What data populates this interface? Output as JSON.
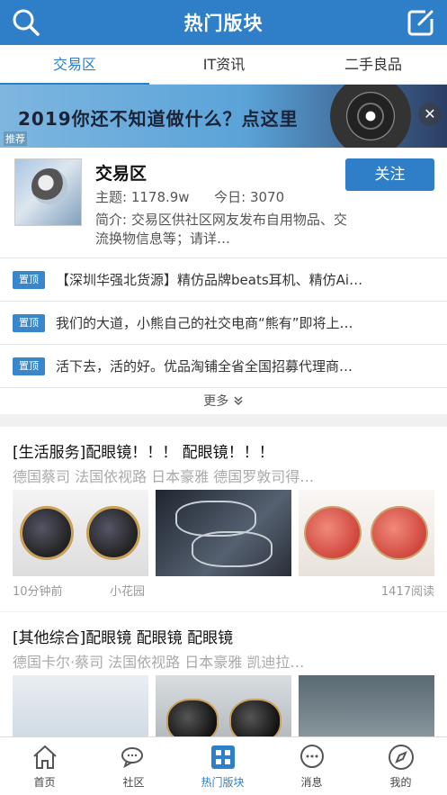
{
  "header": {
    "title": "热门版块",
    "left_icon": "search-icon",
    "right_icon": "edit-icon"
  },
  "tabs": [
    {
      "label": "交易区",
      "active": true
    },
    {
      "label": "IT资讯",
      "active": false
    },
    {
      "label": "二手良品",
      "active": false
    }
  ],
  "banner": {
    "text": "2019你还不知道做什么？点这里",
    "tag": "推荐",
    "close_label": "✕"
  },
  "forum": {
    "name": "交易区",
    "topics_label": "主题: 1178.9w",
    "today_label": "今日: 3070",
    "description": "简介: 交易区供社区网友发布自用物品、交流换物信息等；请详…",
    "follow_label": "关注"
  },
  "pinned": {
    "badge": "置顶",
    "items": [
      "【深圳华强北货源】精仿品牌beats耳机、精仿Ai…",
      "我们的大道，小熊自己的社交电商“熊有”即将上…",
      "活下去，活的好。优品淘铺全省全国招募代理商…"
    ],
    "more_label": "更多"
  },
  "posts": [
    {
      "title": "[生活服务]配眼镜！！！ 配眼镜！！！",
      "subtitle": "德国蔡司 法国依视路 日本豪雅 德国罗敦司得…",
      "time": "10分钟前",
      "author": "小花园",
      "reads": "1417阅读"
    },
    {
      "title": "[其他综合]配眼镜 配眼镜 配眼镜",
      "subtitle": "德国卡尔·蔡司   法国依视路   日本豪雅   凯迪拉…"
    }
  ],
  "bottom_nav": [
    {
      "label": "首页",
      "icon": "home-icon",
      "active": false
    },
    {
      "label": "社区",
      "icon": "chat-bubbles-icon",
      "active": false
    },
    {
      "label": "热门版块",
      "icon": "grid-icon",
      "active": true
    },
    {
      "label": "消息",
      "icon": "message-icon",
      "active": false
    },
    {
      "label": "我的",
      "icon": "compass-icon",
      "active": false
    }
  ],
  "colors": {
    "brand_blue": "#2f7fc8",
    "background": "#f0f0f0",
    "muted_text": "#999999"
  }
}
